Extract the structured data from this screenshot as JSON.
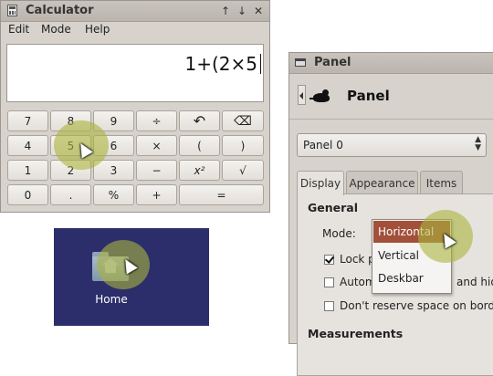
{
  "calculator": {
    "title": "Calculator",
    "titlebar_buttons": [
      "↑",
      "↓",
      "✕"
    ],
    "menu": [
      "Edit",
      "Mode",
      "Help"
    ],
    "display": "1+(2×5",
    "keys": [
      [
        "7",
        "8",
        "9",
        "÷",
        "↶",
        "⌫"
      ],
      [
        "4",
        "5",
        "6",
        "×",
        "(",
        ")"
      ],
      [
        "1",
        "2",
        "3",
        "−",
        "x²",
        "√"
      ],
      [
        "0",
        ".",
        "%",
        "+",
        "="
      ]
    ]
  },
  "desktop": {
    "background_color": "#2c2e6b",
    "icon": "home-folder-icon",
    "label": "Home"
  },
  "panel_window": {
    "title": "Panel",
    "heading": "Panel",
    "panel_select": "Panel 0",
    "tabs": [
      "Display",
      "Appearance",
      "Items"
    ],
    "active_tab": "Display",
    "general_heading": "General",
    "mode_label": "Mode:",
    "mode_options": [
      "Horizontal",
      "Vertical",
      "Deskbar"
    ],
    "mode_selected": "Horizontal",
    "checkboxes": [
      {
        "label": "Lock p",
        "checked": true
      },
      {
        "label": "Autom",
        "suffix": "and hide t",
        "checked": false
      },
      {
        "label": "Don't reserve space on border",
        "checked": false
      }
    ],
    "measurements_heading": "Measurements"
  },
  "colors": {
    "window_bg": "#d7d2cc",
    "highlight": "#a2503a",
    "click_indicator": "#aab43c"
  }
}
